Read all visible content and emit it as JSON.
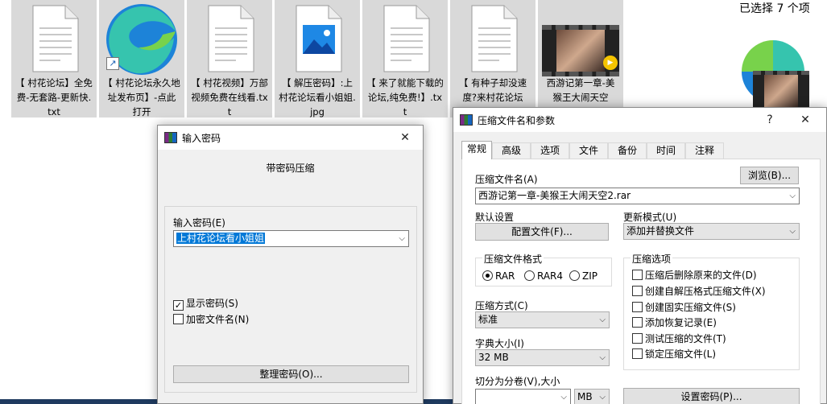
{
  "explorer": {
    "selection_status": "已选择 7 个项",
    "files": [
      {
        "name": "【 村花论坛】全免费-无套路-更新快.txt",
        "icon": "text-file-icon"
      },
      {
        "name": "【 村花论坛永久地址发布页】-点此打开",
        "icon": "edge-shortcut-icon"
      },
      {
        "name": "【 村花视频】万部视频免费在线看.txt",
        "icon": "text-file-icon"
      },
      {
        "name": "【 解压密码】:上村花论坛看小姐姐.jpg",
        "icon": "image-file-icon"
      },
      {
        "name": "【 来了就能下载的论坛,纯免费!】.txt",
        "icon": "text-file-icon"
      },
      {
        "name": "【 有种子却没速度?来村花论坛",
        "icon": "text-file-icon"
      },
      {
        "name": "西游记第一章-美猴王大闹天空",
        "icon": "video-file-icon"
      }
    ]
  },
  "password_dialog": {
    "title": "输入密码",
    "close_glyph": "✕",
    "heading": "带密码压缩",
    "password_label": "输入密码(E)",
    "password_value": "上村花论坛看小姐姐",
    "show_password_label": "显示密码(S)",
    "show_password_checked": true,
    "encrypt_names_label": "加密文件名(N)",
    "encrypt_names_checked": false,
    "organize_button": "整理密码(O)..."
  },
  "archive_dialog": {
    "title": "压缩文件名和参数",
    "help_glyph": "?",
    "close_glyph": "✕",
    "tabs": [
      "常规",
      "高级",
      "选项",
      "文件",
      "备份",
      "时间",
      "注释"
    ],
    "active_tab": "常规",
    "archive_name_label": "压缩文件名(A)",
    "browse_button": "浏览(B)...",
    "archive_name_value": "西游记第一章-美猴王大闹天空2.rar",
    "default_settings_label": "默认设置",
    "profiles_button": "配置文件(F)...",
    "update_mode_label": "更新模式(U)",
    "update_mode_value": "添加并替换文件",
    "format_group_title": "压缩文件格式",
    "formats": [
      {
        "label": "RAR",
        "checked": true
      },
      {
        "label": "RAR4",
        "checked": false
      },
      {
        "label": "ZIP",
        "checked": false
      }
    ],
    "method_label": "压缩方式(C)",
    "method_value": "标准",
    "dict_label": "字典大小(I)",
    "dict_value": "32 MB",
    "split_label": "切分为分卷(V),大小",
    "split_value": "",
    "split_unit": "MB",
    "options_group_title": "压缩选项",
    "options": [
      {
        "label": "压缩后删除原来的文件(D)",
        "checked": false
      },
      {
        "label": "创建自解压格式压缩文件(X)",
        "checked": false
      },
      {
        "label": "创建固实压缩文件(S)",
        "checked": false
      },
      {
        "label": "添加恢复记录(E)",
        "checked": false
      },
      {
        "label": "测试压缩的文件(T)",
        "checked": false
      },
      {
        "label": "锁定压缩文件(L)",
        "checked": false
      }
    ],
    "set_password_button": "设置密码(P)..."
  },
  "glyphs": {
    "dropdown": "⌵",
    "check": "✓",
    "shortcut": "↗",
    "player": "▶"
  },
  "colors": {
    "selection": "#cce8ff",
    "accent": "#0078d7"
  }
}
